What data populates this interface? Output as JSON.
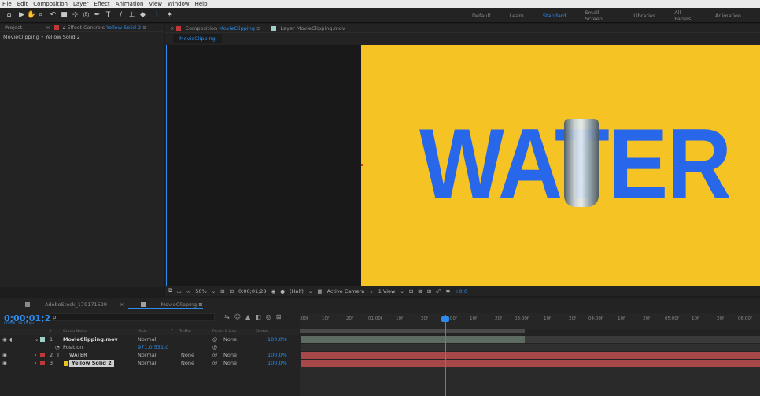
{
  "menubar": [
    "File",
    "Edit",
    "Composition",
    "Layer",
    "Effect",
    "Animation",
    "View",
    "Window",
    "Help"
  ],
  "workspaces": [
    "Default",
    "Learn",
    "Standard",
    "Small Screen",
    "Libraries",
    "All Panels",
    "Animation"
  ],
  "left_panel": {
    "project_tab": "Project",
    "effect_controls_label": "Effect Controls",
    "effect_controls_target": "Yellow Solid 2",
    "breadcrumb": "MovieClipping • Yellow Solid 2"
  },
  "comp_panel": {
    "tab_prefix": "Composition",
    "tab_name": "MovieClipping",
    "layer_tab": "Layer MovieClipping.mov",
    "subtab": "MovieClipping"
  },
  "canvas": {
    "word": "WATER",
    "bg_color": "#f6c324",
    "text_color": "#2867e9"
  },
  "viewer_bar": {
    "zoom": "50%",
    "timecode": "0;00;01;28",
    "resolution": "(Half)",
    "camera": "Active Camera",
    "view": "1 View",
    "exposure": "+0.0"
  },
  "timeline": {
    "tab1": "AdobeStock_179171529",
    "tab2": "MovieClipping",
    "timecode": "0;00;01;28",
    "fps": "00058 (29.97 fps)",
    "search_placeholder": "ρ.",
    "columns": [
      "#",
      "Source Name",
      "Mode",
      "T",
      "TrkMat",
      "Parent & Link",
      "Stretch"
    ],
    "layers": [
      {
        "num": "1",
        "name": "MovieClipping.mov",
        "mode": "Normal",
        "trkmat": "",
        "parent": "None",
        "stretch": "100.0%"
      },
      {
        "num": "",
        "name": "Position",
        "mode": "971.0,531.0",
        "trkmat": "",
        "parent": "",
        "stretch": ""
      },
      {
        "num": "2",
        "name": "WATER",
        "mode": "Normal",
        "trkmat": "None",
        "parent": "None",
        "stretch": "100.0%"
      },
      {
        "num": "3",
        "name": "Yellow Solid 2",
        "mode": "Normal",
        "trkmat": "None",
        "parent": "None",
        "stretch": "100.0%"
      }
    ],
    "ruler": [
      ":00f",
      "10f",
      "20f",
      "01:00f",
      "10f",
      "20f",
      "02:00f",
      "10f",
      "20f",
      "03:00f",
      "10f",
      "20f",
      "04:00f",
      "10f",
      "20f",
      "05:00f",
      "10f",
      "20f",
      "06:00f"
    ]
  }
}
